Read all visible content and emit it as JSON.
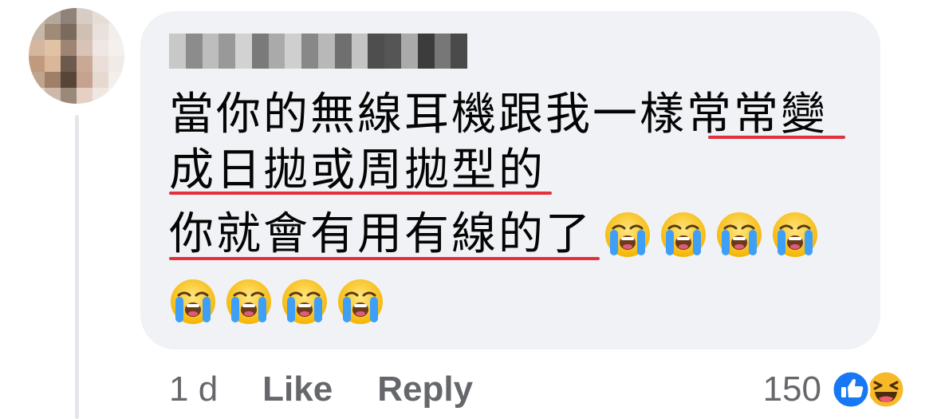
{
  "comment": {
    "author_name": "",
    "lines": [
      "當你的無線耳機跟我一樣常常變",
      "成日拋或周拋型的",
      "你就會有用有線的了"
    ],
    "emoji": [
      "loudly-crying-face",
      "loudly-crying-face",
      "loudly-crying-face",
      "loudly-crying-face",
      "loudly-crying-face",
      "loudly-crying-face",
      "loudly-crying-face",
      "loudly-crying-face"
    ],
    "underline_color": "#e3303d"
  },
  "actions": {
    "time": "1 d",
    "like_label": "Like",
    "reply_label": "Reply"
  },
  "reactions": {
    "count": "150",
    "icons": [
      "like-reaction",
      "haha-reaction"
    ]
  },
  "colors": {
    "bubble": "#f0f2f5",
    "meta_text": "#65676b",
    "like_blue": "#1877f2",
    "haha_yellow": "#f7b928"
  }
}
